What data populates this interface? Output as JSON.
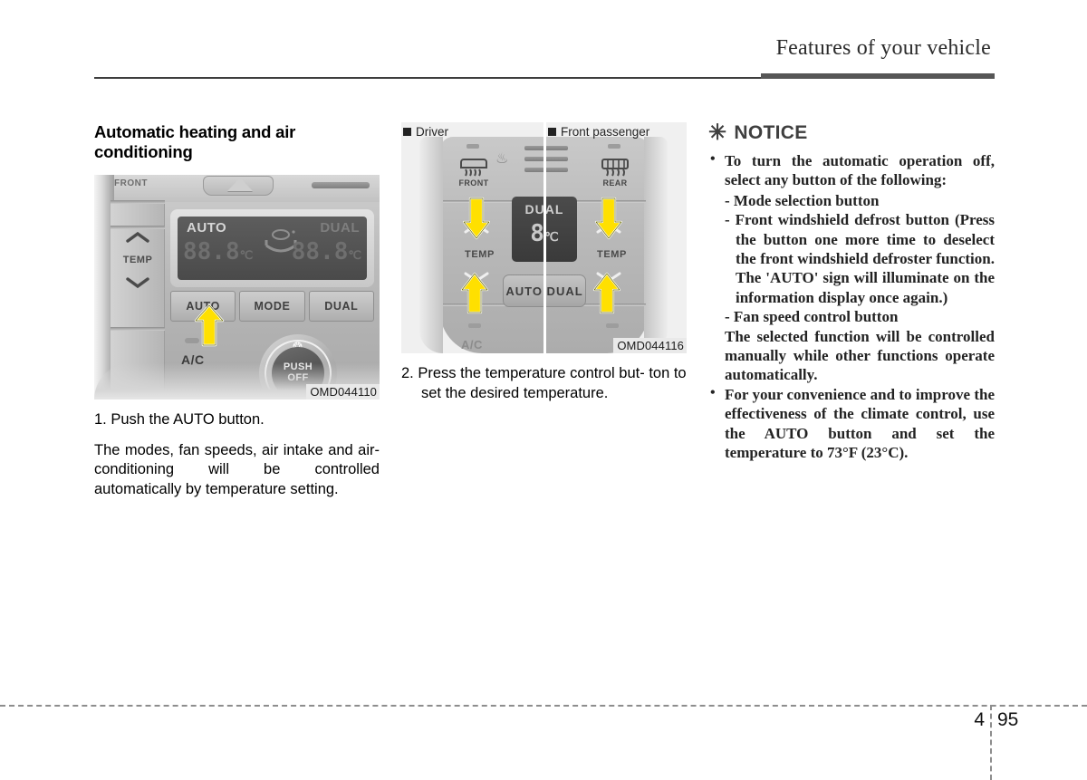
{
  "header": {
    "title": "Features of your vehicle"
  },
  "footer": {
    "chapter": "4",
    "page": "95"
  },
  "left_column": {
    "section_title": "Automatic heating and air conditioning",
    "figure": {
      "code": "OMD044110",
      "display": {
        "auto": "AUTO",
        "dual": "DUAL",
        "left_temp": "88.8",
        "left_unit": "℃",
        "right_temp": "88.8",
        "right_unit": "℃"
      },
      "labels": {
        "front": "FRONT",
        "temp": "TEMP",
        "ac": "A/C",
        "knob_push": "PUSH",
        "knob_off": "OFF"
      },
      "buttons": [
        "AUTO",
        "MODE",
        "DUAL"
      ]
    },
    "step": "1. Push the AUTO button.",
    "paragraph": "The modes, fan speeds, air intake and air-conditioning will be controlled automatically by temperature setting."
  },
  "mid_column": {
    "figure": {
      "code": "OMD044116",
      "label_driver": "Driver",
      "label_passenger": "Front passenger",
      "defrost_front": "FRONT",
      "defrost_rear": "REAR",
      "temp_left": "TEMP",
      "temp_right": "TEMP",
      "display_dual": "DUAL",
      "display_temp": "8",
      "display_unit": "℃",
      "button_autodual": "AUTO DUAL",
      "ac_label": "A/C"
    },
    "step_line1": "2. Press the temperature control but-",
    "step_line2": "ton to set the desired temperature."
  },
  "notice": {
    "heading": "NOTICE",
    "asterisk": "✳",
    "bullet1": "To turn the automatic operation off, select any button of the following:",
    "sub1": "- Mode selection button",
    "sub2": "- Front windshield defrost button (Press the button one more time to deselect the front windshield defroster function. The 'AUTO' sign will illuminate on the information display once again.)",
    "sub3": "- Fan speed control button",
    "cont1": "The selected function will be controlled manually while other functions operate automatically.",
    "bullet2": "For your convenience and to improve the effectiveness of the climate control, use the AUTO button and set the temperature to 73°F (23°C)."
  },
  "colors": {
    "accent_arrow": "#FFE000",
    "header_rule": "#3d3d3d",
    "notice_gray": "#3f3f3f",
    "code_badge_bg": "#e9e9e9"
  }
}
